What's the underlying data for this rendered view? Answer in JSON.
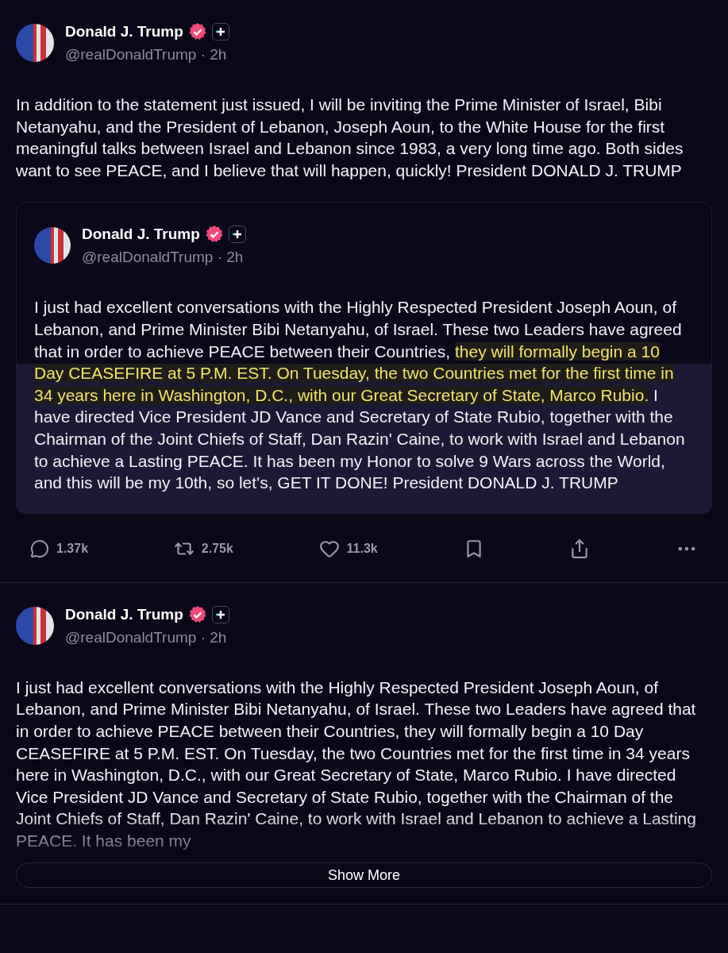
{
  "separator": "·",
  "posts": [
    {
      "author": {
        "name": "Donald J. Trump",
        "handle": "@realDonaldTrump",
        "time": "2h",
        "verified": true
      },
      "body": [
        {
          "text": "In addition to the statement just issued, I will be inviting the Prime Minister of Israel, Bibi Netanyahu, and the President of Lebanon, Joseph Aoun, to the White House for the first meaningful talks between Israel and Lebanon since 1983, a very long time ago. Both sides want to see PEACE, and I believe that will happen, quickly! President DONALD J. TRUMP",
          "highlighted": false
        }
      ],
      "quote": {
        "author": {
          "name": "Donald J. Trump",
          "handle": "@realDonaldTrump",
          "time": "2h",
          "verified": true
        },
        "body": [
          {
            "text": "I just had excellent conversations with the Highly Respected President Joseph Aoun, of Lebanon, and Prime Minister Bibi Netanyahu, of Israel. These two Leaders have agreed that in order to achieve PEACE between their Countries, ",
            "highlighted": false
          },
          {
            "text": "they will formally begin a 10 Day CEASEFIRE at 5 P.M. EST. On Tuesday, the two Countries met for the first time in 34 years here in Washington, D.C., with our Great Secretary of State, Marco Rubio.",
            "highlighted": true
          },
          {
            "text": " I have directed Vice President JD Vance and Secretary of State Rubio, together with the Chairman of the Joint Chiefs of Staff, Dan Razin' Caine, to work with Israel and Lebanon to achieve a Lasting PEACE. It has been my Honor to solve 9 Wars across the World, and this will be my 10th, so let's, GET IT DONE! President DONALD J. TRUMP",
            "highlighted": false
          }
        ]
      },
      "actions": {
        "replies": "1.37k",
        "reposts": "2.75k",
        "likes": "11.3k"
      }
    },
    {
      "author": {
        "name": "Donald J. Trump",
        "handle": "@realDonaldTrump",
        "time": "2h",
        "verified": true
      },
      "body": [
        {
          "text": "I just had excellent conversations with the Highly Respected President Joseph Aoun, of Lebanon, and Prime Minister Bibi Netanyahu, of Israel. These two Leaders have agreed that in order to achieve PEACE between their Countries, they will formally begin a 10 Day CEASEFIRE at 5 P.M. EST. On Tuesday, the two Countries met for the first time in 34 years here in Washington, D.C., with our Great Secretary of State, Marco Rubio. I have directed Vice President JD Vance and Secretary of State Rubio, together with the Chairman of the Joint Chiefs of Staff, Dan Razin' Caine, to work with Israel and Lebanon to achieve a Lasting PEACE. It has been my",
          "highlighted": false
        }
      ],
      "truncated": true,
      "show_more": "Show More"
    }
  ]
}
